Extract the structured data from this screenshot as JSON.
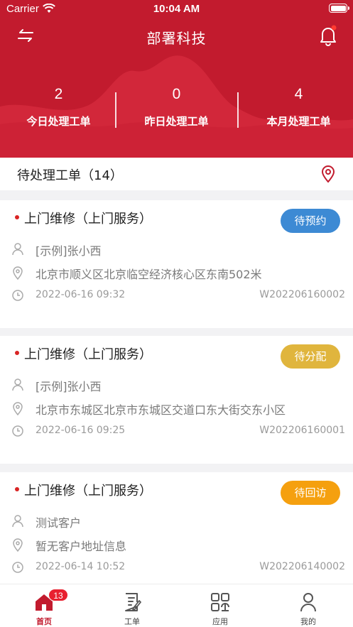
{
  "status_bar": {
    "carrier": "Carrier",
    "time": "10:04 AM"
  },
  "header": {
    "title": "部署科技",
    "bell_has_notification": true
  },
  "stats": [
    {
      "value": "2",
      "label": "今日处理工单"
    },
    {
      "value": "0",
      "label": "昨日处理工单"
    },
    {
      "value": "4",
      "label": "本月处理工单"
    }
  ],
  "pending": {
    "title": "待处理工单（14）"
  },
  "orders": [
    {
      "title": "上门维修（上门服务）",
      "status": "待预约",
      "status_color": "#3d8ad4",
      "customer": "[示例]张小西",
      "address": "北京市顺义区北京临空经济核心区东南502米",
      "datetime": "2022-06-16 09:32",
      "code": "W202206160002"
    },
    {
      "title": "上门维修（上门服务）",
      "status": "待分配",
      "status_color": "#e0b53d",
      "customer": "[示例]张小西",
      "address": "北京市东城区北京市东城区交道口东大街交东小区",
      "datetime": "2022-06-16 09:25",
      "code": "W202206160001"
    },
    {
      "title": "上门维修（上门服务）",
      "status": "待回访",
      "status_color": "#f5a00f",
      "customer": "测试客户",
      "address": "暂无客户地址信息",
      "datetime": "2022-06-14 10:52",
      "code": "W202206140002"
    }
  ],
  "tabbar": {
    "items": [
      {
        "label": "首页",
        "icon": "home-icon",
        "badge": "13",
        "active": true
      },
      {
        "label": "工单",
        "icon": "work-order-icon"
      },
      {
        "label": "应用",
        "icon": "apps-icon"
      },
      {
        "label": "我的",
        "icon": "profile-icon"
      }
    ]
  },
  "colors": {
    "brand": "#c21b2e",
    "accent_dot": "#d92424"
  }
}
